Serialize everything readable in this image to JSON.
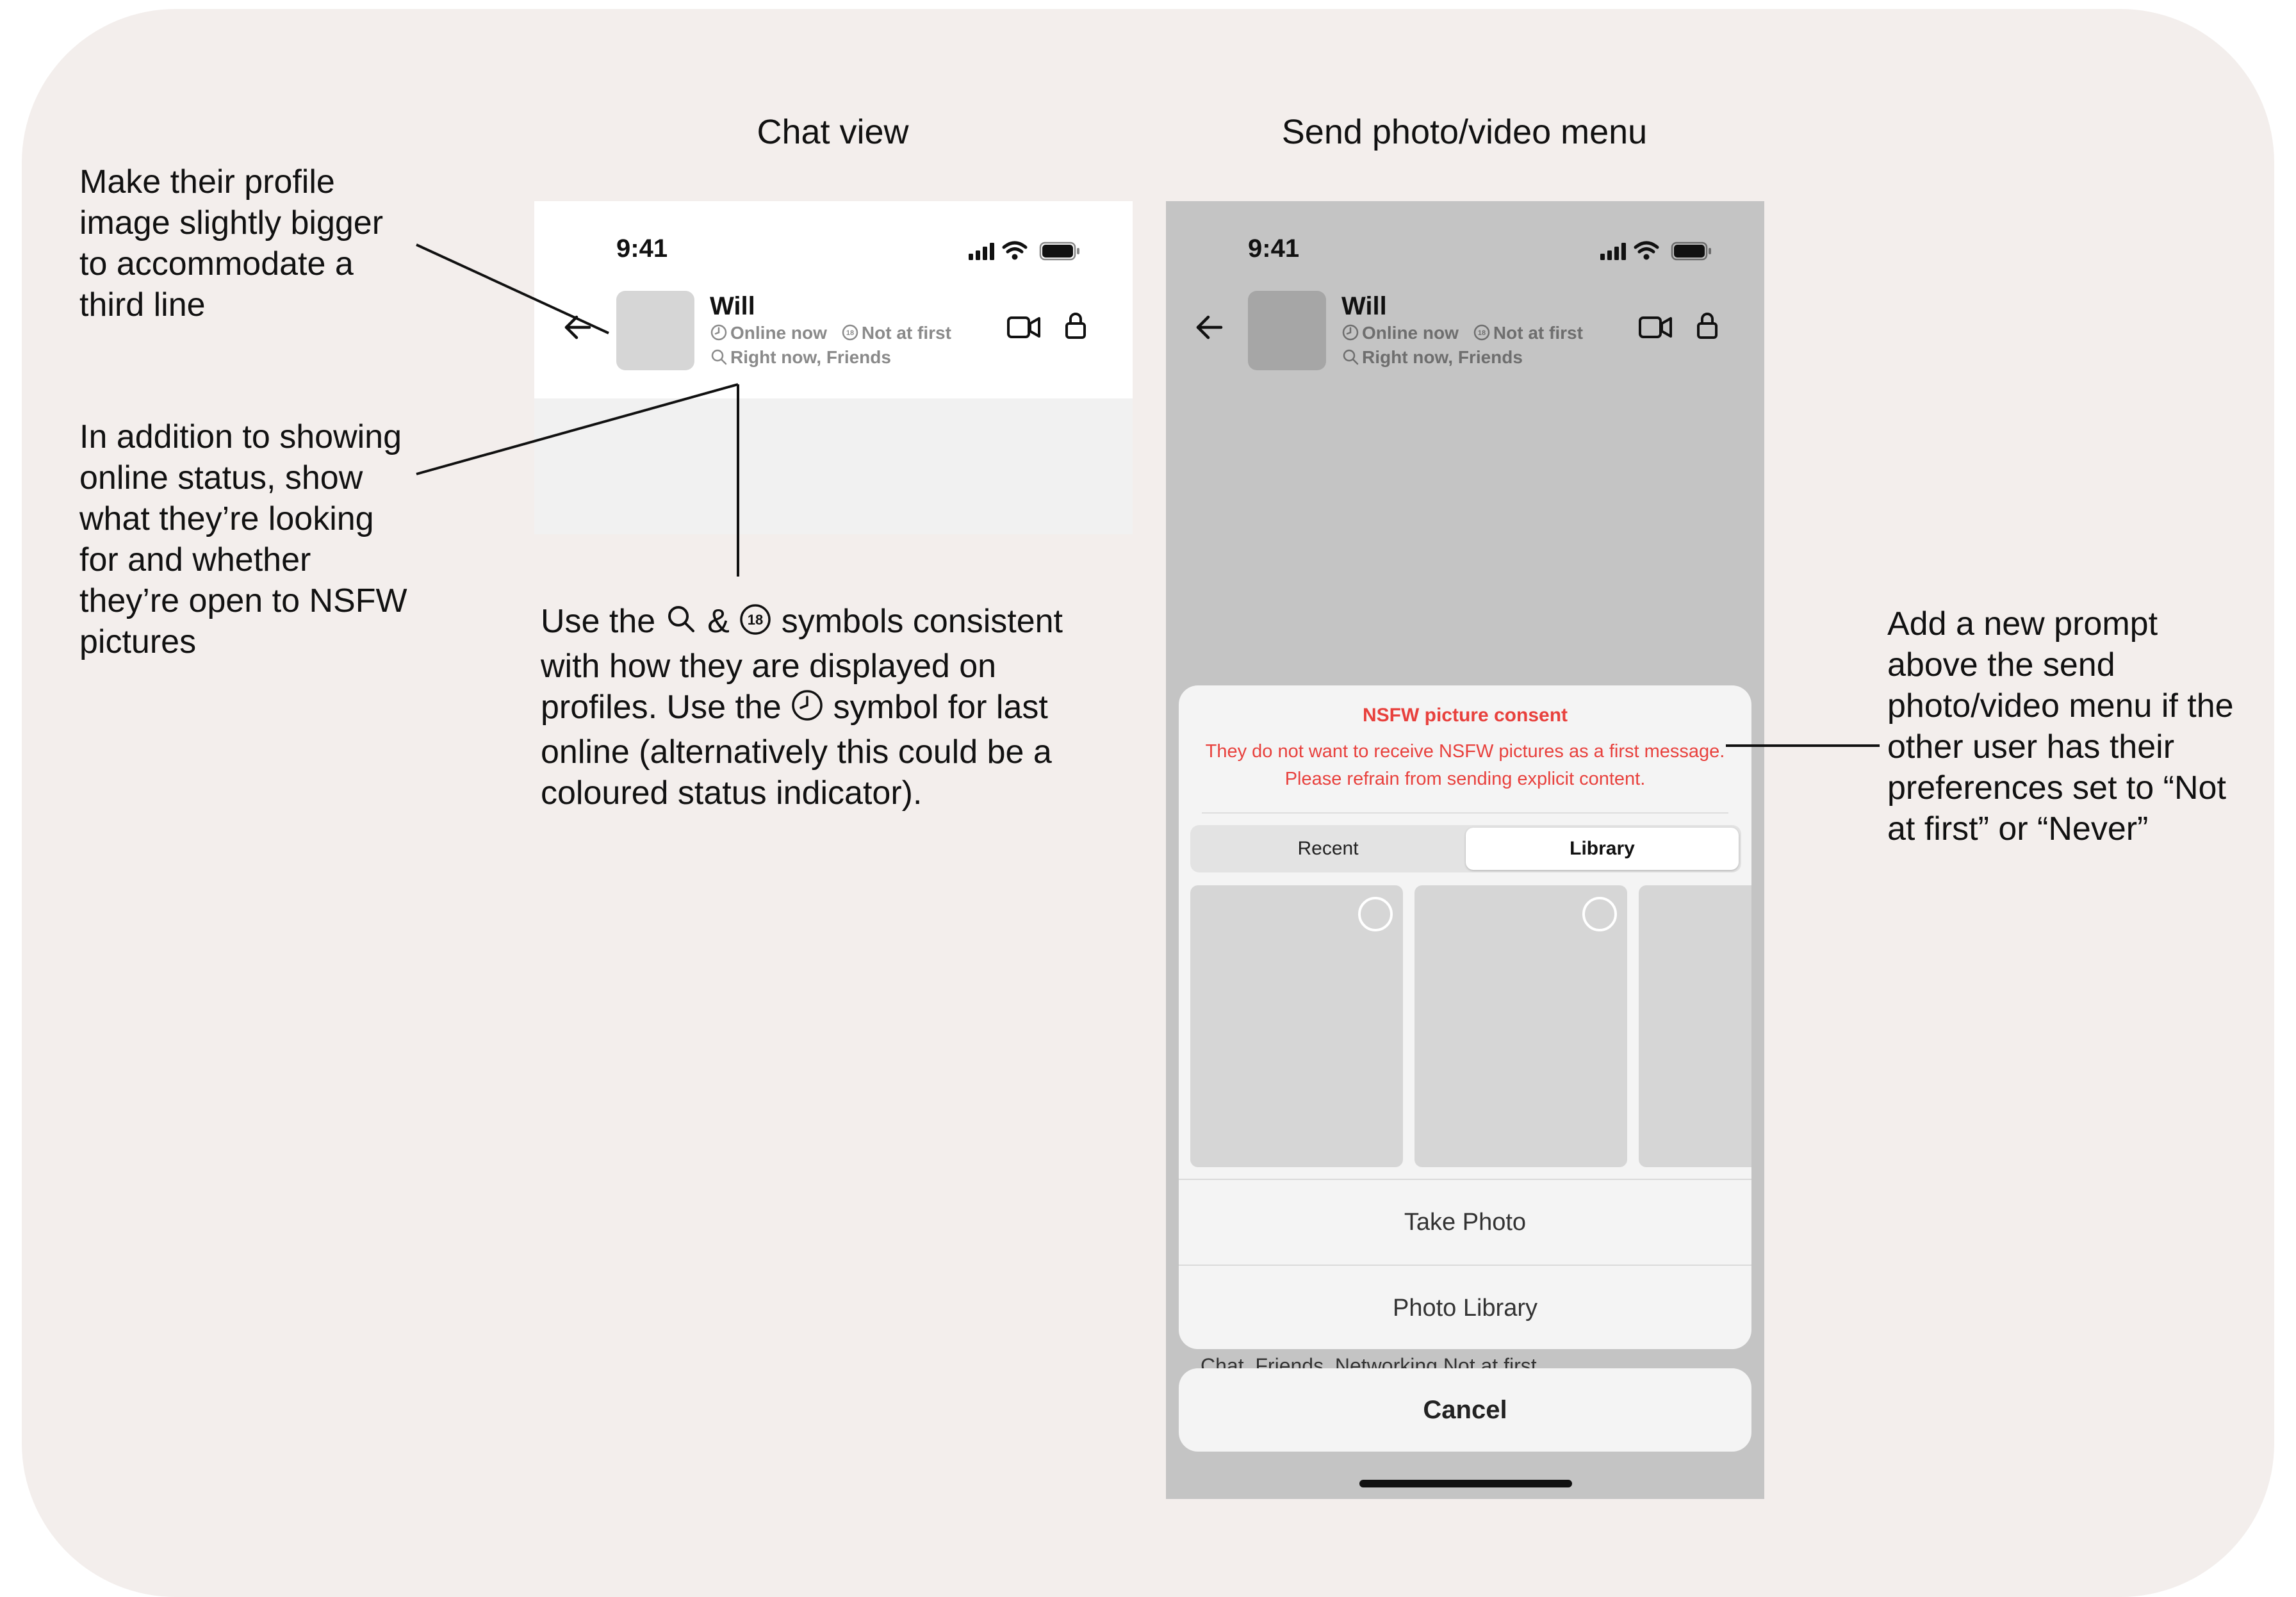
{
  "headings": {
    "chat_view": "Chat view",
    "send_menu": "Send photo/video menu"
  },
  "annotations": {
    "profile_image": "Make their profile image slightly bigger to accommodate a third line",
    "online_status": "In addition to showing online status, show what they’re looking for and whether they’re open to NSFW pictures",
    "symbols_part1": "Use the",
    "symbols_and": "&",
    "symbols_part2": "symbols consistent with how they are displayed on profiles. Use the",
    "symbols_part3": "symbol for last online (alternatively this could be a coloured status indicator).",
    "new_prompt": "Add a new prompt above the send photo/video menu if the other user has their preferences set to “Not at first” or “Never”"
  },
  "chat_screen": {
    "time": "9:41",
    "name": "Will",
    "online": "Online now",
    "nsfw_pref": "Not at first",
    "looking_for": "Right now, Friends"
  },
  "menu_screen": {
    "time": "9:41",
    "name": "Will",
    "online": "Online now",
    "nsfw_pref": "Not at first",
    "looking_for": "Right now, Friends",
    "consent_title": "NSFW picture consent",
    "consent_message": "They do not want to receive NSFW pictures as a first message. Please refrain from sending explicit content.",
    "tab_recent": "Recent",
    "tab_library": "Library",
    "take_photo": "Take Photo",
    "photo_library": "Photo Library",
    "background_peek": "Chat, Friends, Networking",
    "background_peek_nsfw": "Not at first",
    "cancel": "Cancel"
  },
  "colors": {
    "board": "#f3eeec",
    "warning_red": "#e8413d",
    "overlay_gray": "#c4c4c4"
  }
}
